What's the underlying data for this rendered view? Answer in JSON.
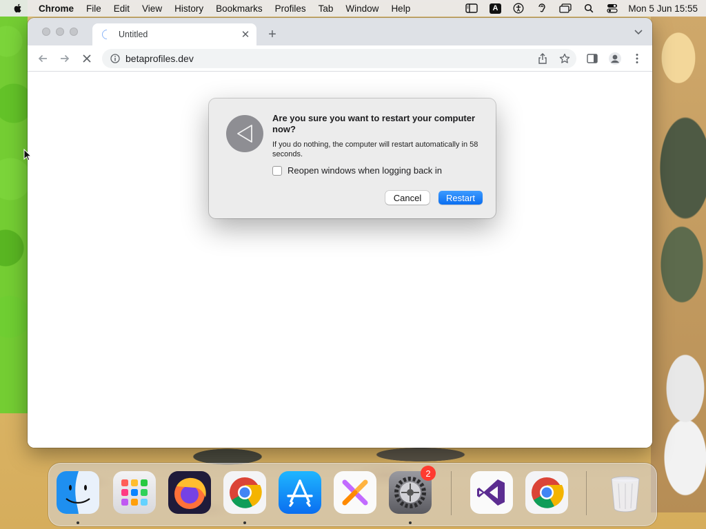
{
  "menubar": {
    "app_name": "Chrome",
    "menus": [
      "File",
      "Edit",
      "View",
      "History",
      "Bookmarks",
      "Profiles",
      "Tab",
      "Window",
      "Help"
    ],
    "input_badge": "A",
    "clock": "Mon 5 Jun  15:55"
  },
  "browser": {
    "tab_title": "Untitled",
    "url": "betaprofiles.dev"
  },
  "dialog": {
    "title": "Are you sure you want to restart your computer now?",
    "message": "If you do nothing, the computer will restart automatically in 58 seconds.",
    "checkbox_label": "Reopen windows when logging back in",
    "checkbox_checked": false,
    "cancel_label": "Cancel",
    "confirm_label": "Restart"
  },
  "dock": {
    "items": [
      {
        "name": "finder",
        "running": true
      },
      {
        "name": "launchpad",
        "running": false
      },
      {
        "name": "firefox",
        "running": false
      },
      {
        "name": "chrome",
        "running": true
      },
      {
        "name": "app-store",
        "running": false
      },
      {
        "name": "xcode-tool",
        "running": false
      },
      {
        "name": "system-preferences",
        "running": true,
        "badge": "2"
      },
      {
        "name": "visual-studio",
        "running": false
      },
      {
        "name": "chrome-beta",
        "running": false
      },
      {
        "name": "trash",
        "running": false
      }
    ]
  },
  "colors": {
    "accent": "#0a6ef0",
    "badge": "#ff3b30",
    "tabstrip": "#dee1e6"
  }
}
